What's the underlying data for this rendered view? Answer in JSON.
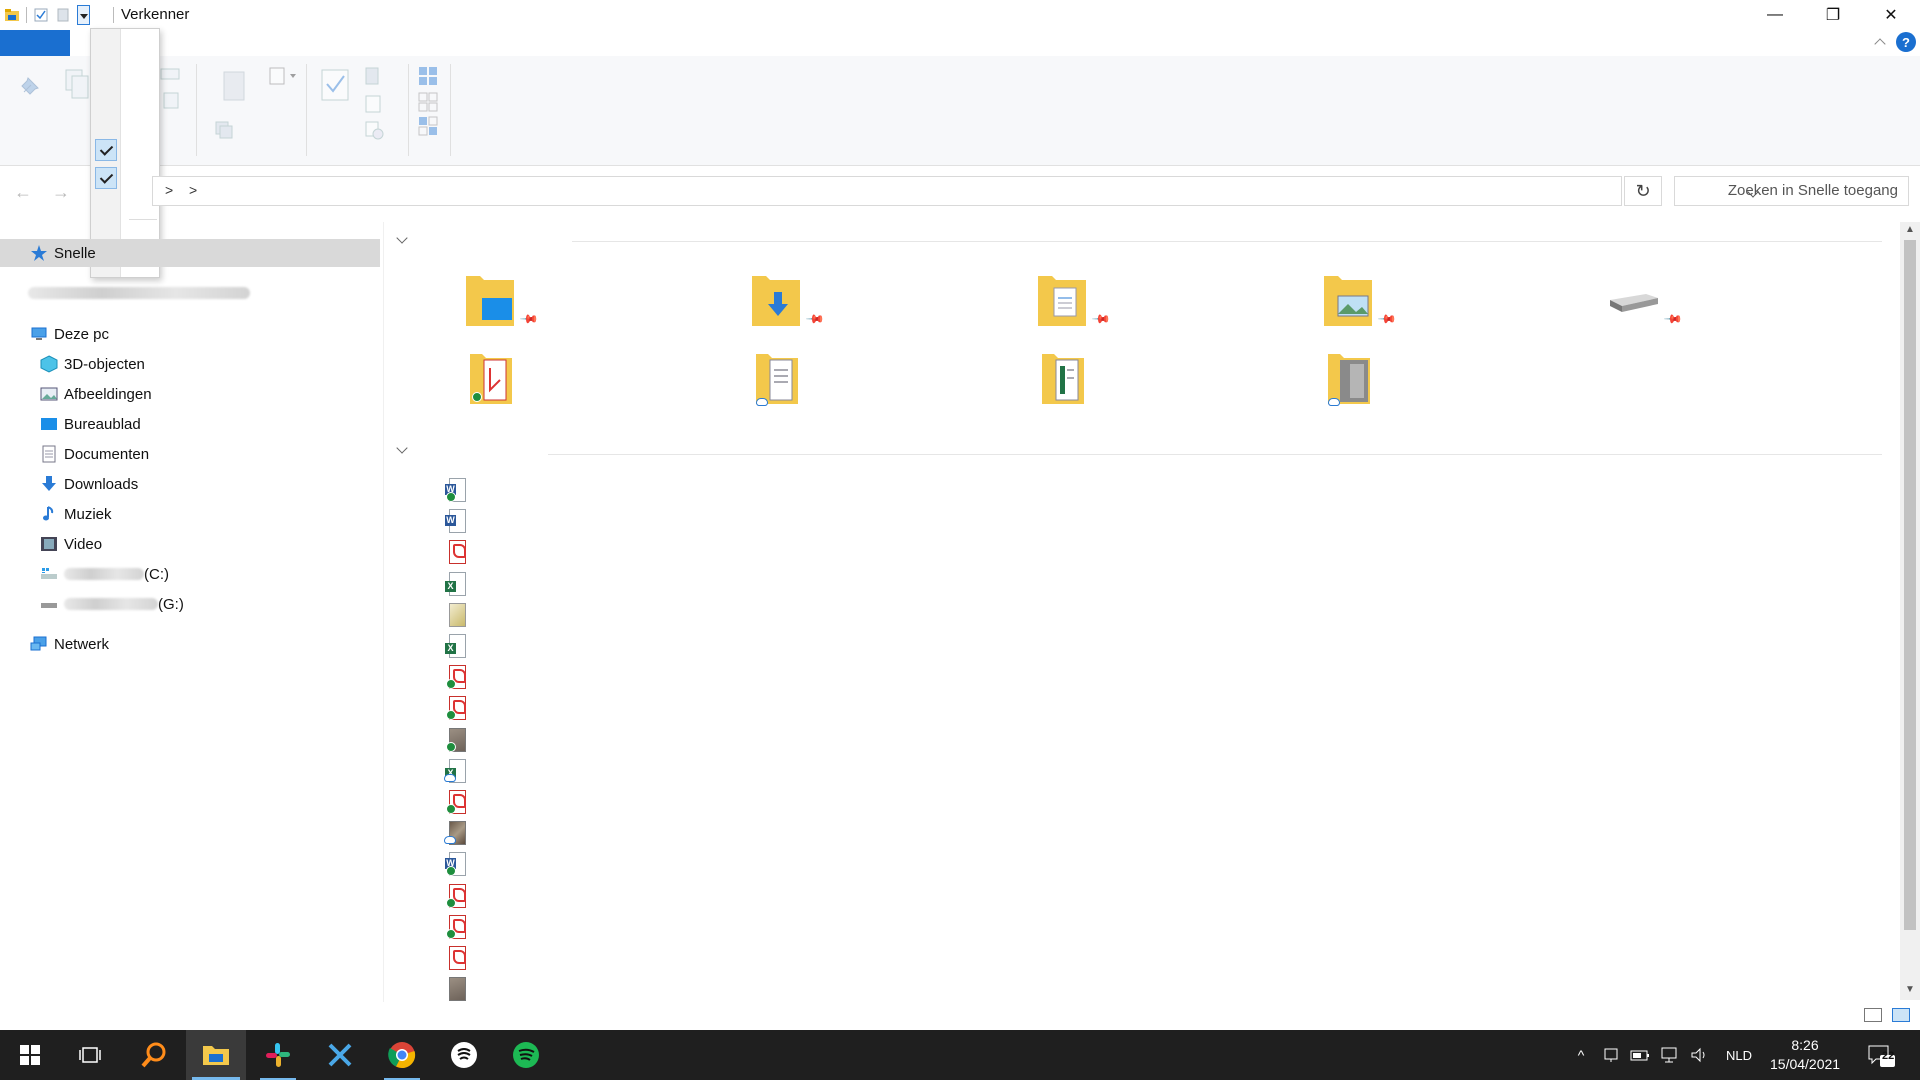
{
  "window": {
    "title": "Verkenner",
    "controls": {
      "minimize": "—",
      "maximize": "❐",
      "close": "✕"
    },
    "help": "?"
  },
  "address": {
    "separators": [
      ">",
      ">"
    ],
    "refresh": "↻",
    "search_placeholder": "Zoeken in Snelle toegang"
  },
  "nav": {
    "quick_access": "Snelle",
    "this_pc": "Deze pc",
    "items": [
      {
        "label": "3D-objecten",
        "icon": "3d-objects-icon"
      },
      {
        "label": "Afbeeldingen",
        "icon": "pictures-icon"
      },
      {
        "label": "Bureaublad",
        "icon": "desktop-icon"
      },
      {
        "label": "Documenten",
        "icon": "documents-icon"
      },
      {
        "label": "Downloads",
        "icon": "downloads-icon"
      },
      {
        "label": "Muziek",
        "icon": "music-icon"
      },
      {
        "label": "Video",
        "icon": "video-icon"
      }
    ],
    "drive_c": "(C:)",
    "drive_g": "(G:)",
    "network": "Netwerk"
  },
  "frequent_folders": [
    {
      "icon": "desktop-folder-icon",
      "pinned": true
    },
    {
      "icon": "downloads-folder-icon",
      "pinned": true
    },
    {
      "icon": "documents-folder-icon",
      "pinned": true
    },
    {
      "icon": "pictures-folder-icon",
      "pinned": true
    },
    {
      "icon": "drive-icon",
      "pinned": true
    },
    {
      "icon": "pdf-folder-icon",
      "status": "synced"
    },
    {
      "icon": "document-folder-icon",
      "status": "cloud"
    },
    {
      "icon": "spreadsheet-folder-icon",
      "status": "none"
    },
    {
      "icon": "image-folder-icon",
      "status": "cloud"
    }
  ],
  "recent_files": [
    {
      "type": "word",
      "status": "synced"
    },
    {
      "type": "word",
      "status": "none"
    },
    {
      "type": "pdf",
      "status": "none"
    },
    {
      "type": "excel",
      "status": "none"
    },
    {
      "type": "pencil",
      "status": "none"
    },
    {
      "type": "excel",
      "status": "none"
    },
    {
      "type": "pdf",
      "status": "synced"
    },
    {
      "type": "pdf",
      "status": "synced"
    },
    {
      "type": "img",
      "status": "synced"
    },
    {
      "type": "excel",
      "status": "cloud"
    },
    {
      "type": "pdf",
      "status": "synced"
    },
    {
      "type": "photo",
      "status": "cloud"
    },
    {
      "type": "word",
      "status": "synced"
    },
    {
      "type": "pdf",
      "status": "synced"
    },
    {
      "type": "pdf",
      "status": "synced"
    },
    {
      "type": "pdf",
      "status": "none"
    },
    {
      "type": "img",
      "status": "none"
    }
  ],
  "taskbar": {
    "apps": [
      "start-icon",
      "task-view-icon",
      "search-icon",
      "file-explorer-icon",
      "slack-icon",
      "app-x-icon",
      "chrome-icon",
      "app-s-icon",
      "spotify-icon"
    ],
    "language": "NLD",
    "time": "8:26",
    "date": "15/04/2021",
    "notifications": "22"
  },
  "colors": {
    "accent": "#1a6fd0",
    "folder": "#f3c84b",
    "taskbar": "#1f1f1f",
    "spotify": "#1db954"
  }
}
